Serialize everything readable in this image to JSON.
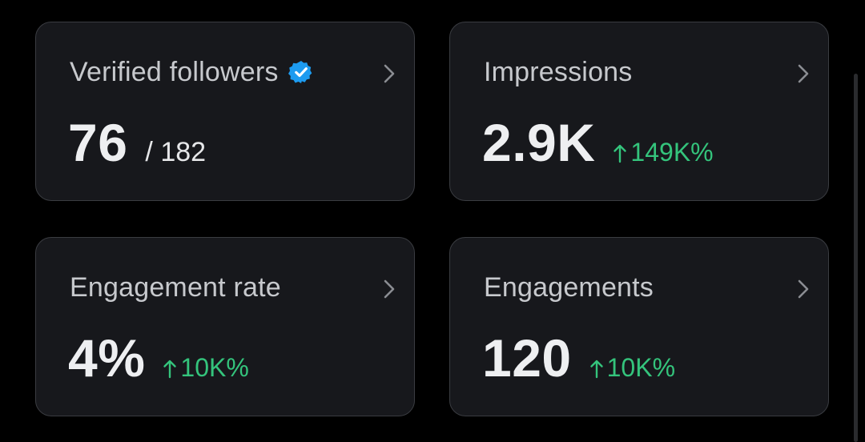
{
  "cards": [
    {
      "title": "Verified followers",
      "value": "76",
      "total": "/ 182"
    },
    {
      "title": "Impressions",
      "value": "2.9K",
      "change": "149K%"
    },
    {
      "title": "Engagement rate",
      "value": "4%",
      "change": "10K%"
    },
    {
      "title": "Engagements",
      "value": "120",
      "change": "10K%"
    }
  ],
  "icons": {
    "verified": "verified-badge-icon",
    "chevron": "chevron-right-icon",
    "up_arrow": "arrow-up-icon"
  },
  "colors": {
    "card_background": "#17181c",
    "card_border": "#3a3c41",
    "title_text": "#c7c9cd",
    "value_text": "#eeeff1",
    "positive_change": "#34c47c",
    "verified_blue": "#1d9bf0",
    "chevron": "#8b8d92"
  }
}
